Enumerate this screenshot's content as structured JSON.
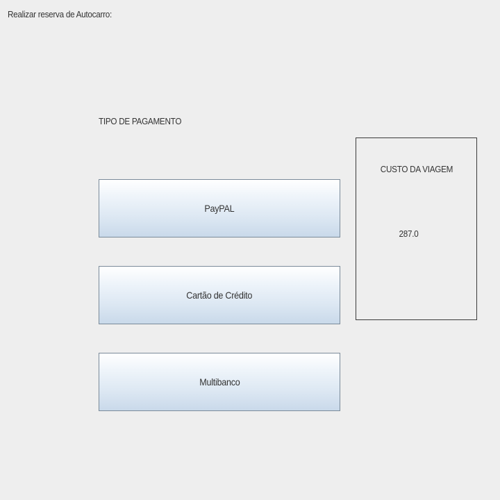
{
  "window": {
    "title": "Realizar reserva de Autocarro:"
  },
  "payment": {
    "section_label": "TIPO DE PAGAMENTO",
    "buttons": [
      {
        "label": "PayPAL"
      },
      {
        "label": "Cartão de Crédito"
      },
      {
        "label": "Multibanco"
      }
    ]
  },
  "cost": {
    "title": "CUSTO DA VIAGEM",
    "value": "287.0"
  }
}
